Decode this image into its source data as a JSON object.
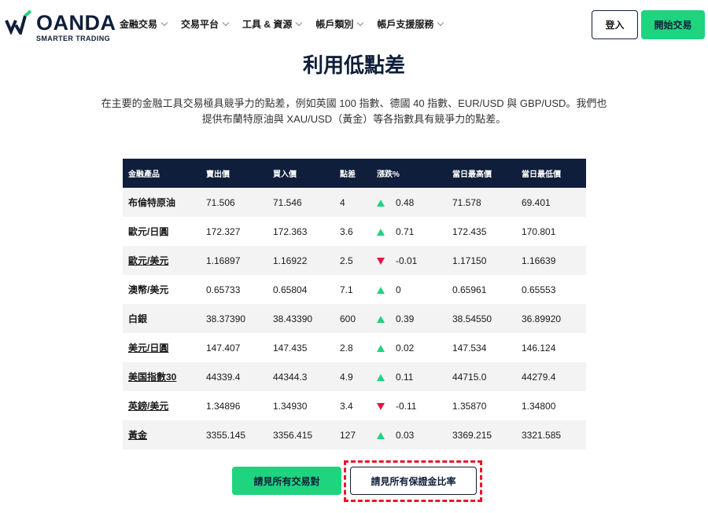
{
  "header": {
    "logo": {
      "word": "OANDA",
      "tagline": "SMARTER TRADING"
    },
    "nav": [
      {
        "label": "金融交易"
      },
      {
        "label": "交易平台"
      },
      {
        "label": "工具 & 資源"
      },
      {
        "label": "帳戶類別"
      },
      {
        "label": "帳戶支援服務"
      }
    ],
    "login_label": "登入",
    "start_label": "開始交易"
  },
  "hero": {
    "title": "利用低點差",
    "desc_line1": "在主要的金融工具交易極具競爭力的點差，例如英國 100 指數、德國 40 指數、EUR/USD 與 GBP/USD。我們也",
    "desc_line2": "提供布蘭特原油與 XAU/USD（黃金）等各指數具有競爭力的點差。"
  },
  "table": {
    "headers": [
      "金融產品",
      "賣出價",
      "買入價",
      "點差",
      "漲跌%",
      "當日最高價",
      "當日最低價"
    ],
    "rows": [
      {
        "instrument": "布倫特原油",
        "bid": "71.506",
        "ask": "71.546",
        "spread": "4",
        "direction": "up",
        "change": "0.48",
        "high": "71.578",
        "low": "69.401"
      },
      {
        "instrument": "歐元/日圓",
        "bid": "172.327",
        "ask": "172.363",
        "spread": "3.6",
        "direction": "up",
        "change": "0.71",
        "high": "172.435",
        "low": "170.801"
      },
      {
        "instrument": "歐元/美元",
        "bid": "1.16897",
        "ask": "1.16922",
        "spread": "2.5",
        "direction": "down",
        "change": "-0.01",
        "high": "1.17150",
        "low": "1.16639"
      },
      {
        "instrument": "澳幣/美元",
        "bid": "0.65733",
        "ask": "0.65804",
        "spread": "7.1",
        "direction": "up",
        "change": "0",
        "high": "0.65961",
        "low": "0.65553"
      },
      {
        "instrument": "白銀",
        "bid": "38.37390",
        "ask": "38.43390",
        "spread": "600",
        "direction": "up",
        "change": "0.39",
        "high": "38.54550",
        "low": "36.89920"
      },
      {
        "instrument": "美元/日圓",
        "bid": "147.407",
        "ask": "147.435",
        "spread": "2.8",
        "direction": "up",
        "change": "0.02",
        "high": "147.534",
        "low": "146.124"
      },
      {
        "instrument": "美国指數30",
        "bid": "44339.4",
        "ask": "44344.3",
        "spread": "4.9",
        "direction": "up",
        "change": "0.11",
        "high": "44715.0",
        "low": "44279.4"
      },
      {
        "instrument": "英鎊/美元",
        "bid": "1.34896",
        "ask": "1.34930",
        "spread": "3.4",
        "direction": "down",
        "change": "-0.11",
        "high": "1.35870",
        "low": "1.34800"
      },
      {
        "instrument": "黃金",
        "bid": "3355.145",
        "ask": "3356.415",
        "spread": "127",
        "direction": "up",
        "change": "0.03",
        "high": "3369.215",
        "low": "3321.585"
      }
    ]
  },
  "actions": {
    "all_pairs_label": "請見所有交易對",
    "all_margin_label": "請見所有保證金比率"
  },
  "colors": {
    "navy": "#0f1e3a",
    "green": "#1ed47f",
    "red": "#e8153e"
  }
}
